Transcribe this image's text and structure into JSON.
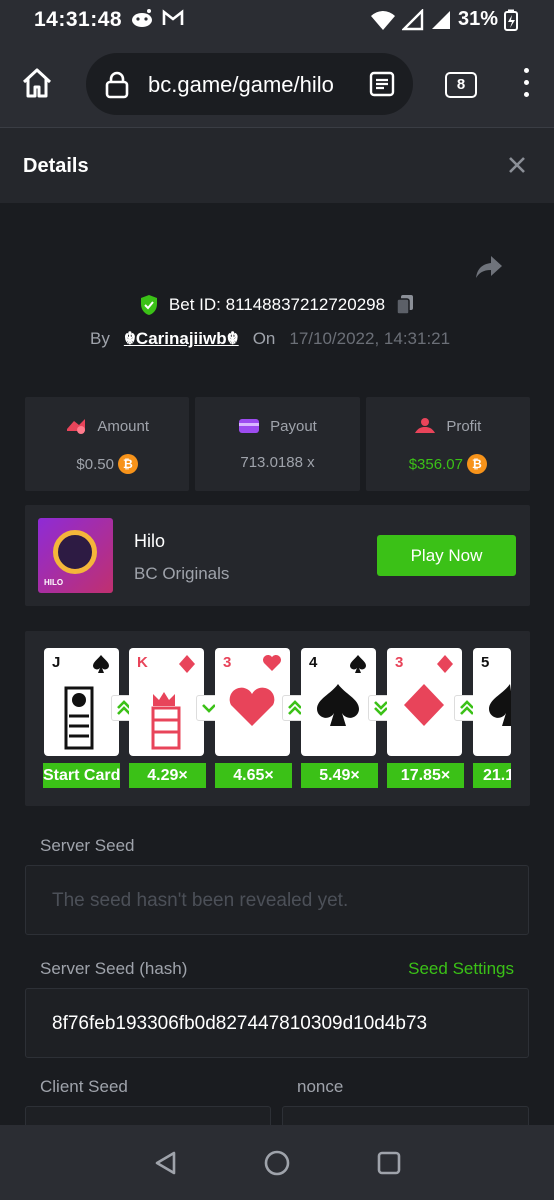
{
  "status": {
    "time": "14:31:48",
    "battery": "31%"
  },
  "browser": {
    "url": "bc.game/game/hilo",
    "tab_count": "8"
  },
  "header": {
    "title": "Details"
  },
  "bet": {
    "id_label": "Bet ID: 81148837212720298",
    "by_label": "By",
    "user": "☬Carinajiiwb☬",
    "on_label": "On",
    "date": "17/10/2022, 14:31:21"
  },
  "stats": [
    {
      "label": "Amount",
      "value": "$0.50",
      "icon": "amount-icon",
      "color": "#e8445a"
    },
    {
      "label": "Payout",
      "value": "713.0188 x",
      "icon": "wallet-icon",
      "color": "#9d4cf0"
    },
    {
      "label": "Profit",
      "value": "$356.07",
      "icon": "profit-icon",
      "color": "#e8445a"
    }
  ],
  "game": {
    "name": "Hilo",
    "provider": "BC Originals",
    "play_label": "Play Now",
    "thumb_text": "HILO"
  },
  "cards": [
    {
      "rank": "J",
      "suit": "spade",
      "color": "#111",
      "mult": "Start Card"
    },
    {
      "rank": "K",
      "suit": "diamond",
      "color": "#e8445a",
      "mult": "4.29×",
      "arrow": "up"
    },
    {
      "rank": "3",
      "suit": "heart",
      "color": "#e8445a",
      "mult": "4.65×",
      "arrow": "down"
    },
    {
      "rank": "4",
      "suit": "spade",
      "color": "#111",
      "mult": "5.49×",
      "arrow": "up"
    },
    {
      "rank": "3",
      "suit": "diamond",
      "color": "#e8445a",
      "mult": "17.85×",
      "arrow": "down"
    },
    {
      "rank": "5",
      "suit": "spade",
      "color": "#111",
      "mult": "21.1",
      "arrow": "up"
    }
  ],
  "server_seed": {
    "label": "Server Seed",
    "placeholder": "The seed hasn't been revealed yet."
  },
  "server_seed_hash": {
    "label": "Server Seed (hash)",
    "settings_label": "Seed Settings",
    "value": "8f76feb193306fb0d827447810309d10d4b73"
  },
  "client_seed": {
    "label": "Client Seed"
  },
  "nonce": {
    "label": "nonce"
  },
  "colors": {
    "accent": "#3bc117",
    "panel": "#25272c",
    "background": "#1a1c20"
  }
}
